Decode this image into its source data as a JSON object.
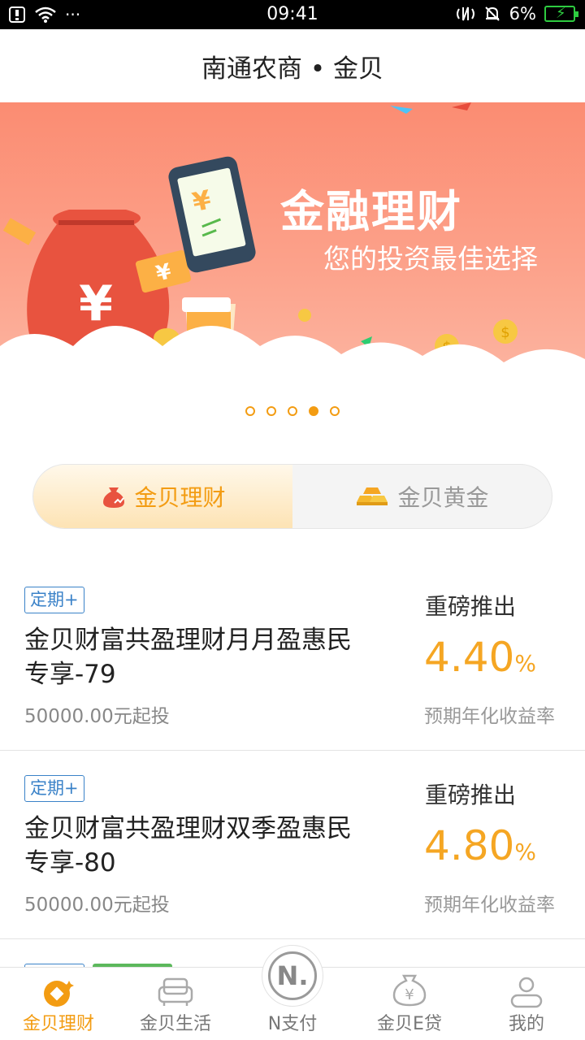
{
  "status_bar": {
    "time": "09:41",
    "battery": "6%",
    "dots": "···"
  },
  "header": {
    "title": "南通农商 • 金贝"
  },
  "banner": {
    "title": "金融理财",
    "subtitle": "您的投资最佳选择",
    "bill_symbol": "¥",
    "dollar_symbol": "$",
    "dots_count": 5,
    "active_dot": 3
  },
  "segment": {
    "tabs": [
      {
        "label": "金贝理财",
        "active": true
      },
      {
        "label": "金贝黄金",
        "active": false
      }
    ]
  },
  "products": [
    {
      "tag": "定期+",
      "name": "金贝财富共盈理财月月盈惠民专享-79",
      "min": "50000.00元起投",
      "launch": "重磅推出",
      "rate": "4.40",
      "rate_unit": "%",
      "rate_label": "预期年化收益率"
    },
    {
      "tag": "定期+",
      "name": "金贝财富共盈理财双季盈惠民专享-80",
      "min": "50000.00元起投",
      "launch": "重磅推出",
      "rate": "4.80",
      "rate_unit": "%",
      "rate_label": "预期年化收益率"
    }
  ],
  "bottom_nav": [
    {
      "label": "金贝理财",
      "icon": "finance-icon",
      "active": true
    },
    {
      "label": "金贝生活",
      "icon": "sofa-icon",
      "active": false
    },
    {
      "label": "N支付",
      "icon": "n-pay-icon",
      "active": false,
      "icon_text": "N."
    },
    {
      "label": "金贝E贷",
      "icon": "money-bag-icon",
      "active": false,
      "icon_text": "¥"
    },
    {
      "label": "我的",
      "icon": "person-icon",
      "active": false
    }
  ],
  "colors": {
    "accent": "#f39c12",
    "tag_blue": "#3a82c8",
    "banner": "#fb8c72"
  }
}
